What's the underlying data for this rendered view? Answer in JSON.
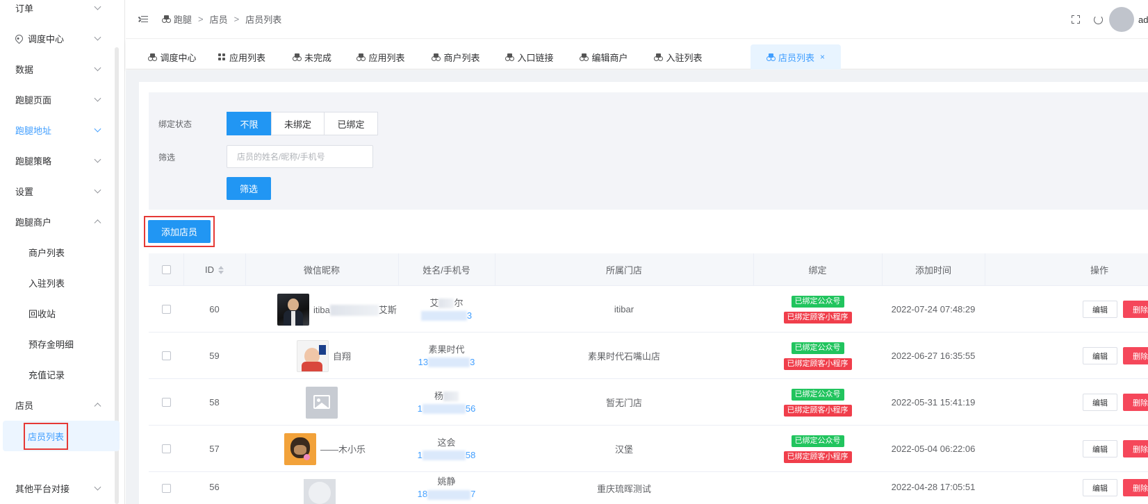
{
  "sidebar": {
    "items": [
      {
        "label": "订单",
        "state": "collapsed"
      },
      {
        "label": "调度中心",
        "state": "collapsed",
        "icon": "location-pin-icon"
      },
      {
        "label": "数据",
        "state": "collapsed"
      },
      {
        "label": "跑腿页面",
        "state": "collapsed"
      },
      {
        "label": "跑腿地址",
        "state": "collapsed"
      },
      {
        "label": "跑腿策略",
        "state": "collapsed"
      },
      {
        "label": "设置",
        "state": "collapsed"
      },
      {
        "label": "跑腿商户",
        "state": "expanded"
      },
      {
        "label": "商户列表",
        "state": "sub"
      },
      {
        "label": "入驻列表",
        "state": "sub"
      },
      {
        "label": "回收站",
        "state": "sub"
      },
      {
        "label": "预存金明细",
        "state": "sub"
      },
      {
        "label": "充值记录",
        "state": "sub"
      },
      {
        "label": "店员",
        "state": "expanded"
      },
      {
        "label": "店员列表",
        "state": "active"
      },
      {
        "label": "其他平台对接",
        "state": "collapsed"
      }
    ]
  },
  "header": {
    "breadcrumb": [
      "跑腿",
      "店员",
      "店员列表"
    ],
    "separator": ">",
    "user_name": "admin"
  },
  "tabs": [
    {
      "label": "调度中心",
      "icon": "motorbike-icon"
    },
    {
      "label": "应用列表",
      "icon": "grid-icon"
    },
    {
      "label": "未完成",
      "icon": "motorbike-icon"
    },
    {
      "label": "应用列表",
      "icon": "motorbike-icon"
    },
    {
      "label": "商户列表",
      "icon": "motorbike-icon"
    },
    {
      "label": "入口链接",
      "icon": "motorbike-icon"
    },
    {
      "label": "编辑商户",
      "icon": "motorbike-icon"
    },
    {
      "label": "入驻列表",
      "icon": "motorbike-icon"
    },
    {
      "label": "店员列表",
      "icon": "motorbike-icon",
      "active": true,
      "close": "×"
    }
  ],
  "filter": {
    "bind_label": "绑定状态",
    "bind_options": [
      "不限",
      "未绑定",
      "已绑定"
    ],
    "bind_selected": "不限",
    "search_label": "筛选",
    "search_placeholder": "店员的姓名/昵称/手机号",
    "search_value": "",
    "search_button": "筛选"
  },
  "add_button": "添加店员",
  "table": {
    "columns": [
      "ID",
      "微信昵称",
      "姓名/手机号",
      "所属门店",
      "绑定",
      "添加时间",
      "操作"
    ],
    "rows": [
      {
        "id": "60",
        "nick_prefix": "itiba",
        "nick_suffix": "艾斯",
        "name_prefix": "艾",
        "name_suffix": "尔",
        "phone_prefix": "",
        "phone_suffix": "3",
        "store": "itibar",
        "tags": [
          "已绑定公众号",
          "已绑定顾客小程序"
        ],
        "time": "2022-07-24 07:48:29",
        "avatar": "suit-photo"
      },
      {
        "id": "59",
        "nick_prefix": "",
        "nick_suffix": "自翔",
        "name_prefix": "素果时代",
        "name_suffix": "",
        "phone_prefix": "13",
        "phone_suffix": "3",
        "store": "素果时代石嘴山店",
        "tags": [
          "已绑定公众号",
          "已绑定顾客小程序"
        ],
        "time": "2022-06-27 16:35:55",
        "avatar": "baby-photo"
      },
      {
        "id": "58",
        "nick_prefix": "",
        "nick_suffix": "",
        "name_prefix": "杨",
        "name_suffix": "",
        "phone_prefix": "1",
        "phone_suffix": "56",
        "store": "暂无门店",
        "tags": [
          "已绑定公众号",
          "已绑定顾客小程序"
        ],
        "time": "2022-05-31 15:41:19",
        "avatar": "default-avatar"
      },
      {
        "id": "57",
        "nick_prefix": "",
        "nick_suffix": "——木小乐",
        "name_prefix": "这会",
        "name_suffix": "",
        "phone_prefix": "1",
        "phone_suffix": "58",
        "store": "汉堡",
        "tags": [
          "已绑定公众号",
          "已绑定顾客小程序"
        ],
        "time": "2022-05-04 06:22:06",
        "avatar": "ape-photo"
      },
      {
        "id": "56",
        "nick_prefix": "",
        "nick_suffix": "",
        "name_prefix": "姚静",
        "name_suffix": "",
        "phone_prefix": "18",
        "phone_suffix": "7",
        "store": "重庆琉晖测试",
        "tags": [],
        "time": "2022-04-28 17:05:51",
        "avatar": "default-avatar-round"
      }
    ],
    "edit_label": "编辑",
    "delete_label": "删除"
  },
  "colors": {
    "primary": "#2196f3",
    "link": "#409eff",
    "danger": "#f5475a",
    "success": "#21c45e",
    "highlight_box": "#e53935"
  }
}
